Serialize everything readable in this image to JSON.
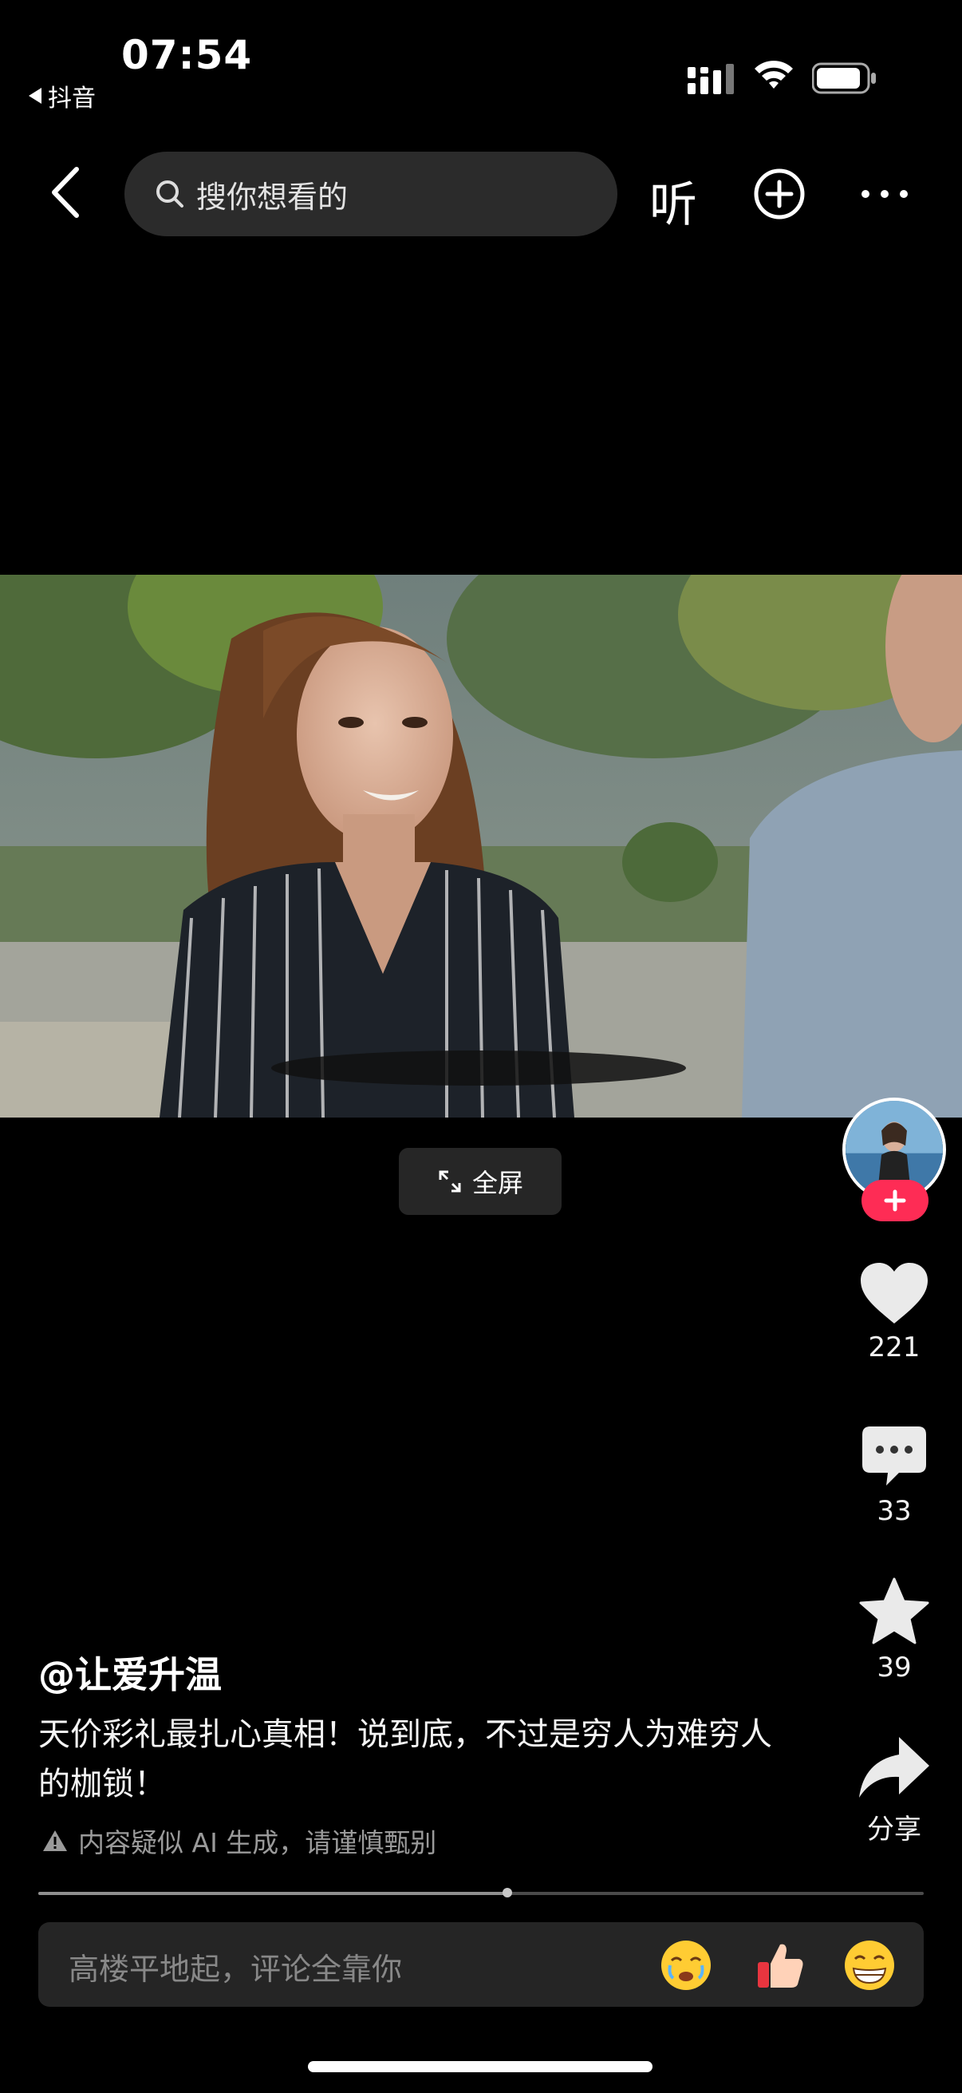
{
  "status_bar": {
    "back_app": "抖音",
    "time": "07:54"
  },
  "top_nav": {
    "search_placeholder": "搜你想看的",
    "listen_label": "听"
  },
  "video": {
    "fullscreen_label": "全屏"
  },
  "actions": {
    "likes": "221",
    "comments": "33",
    "favorites": "39",
    "share_label": "分享"
  },
  "post": {
    "author": "@让爱升温",
    "description": "天价彩礼最扎心真相！说到底，不过是穷人为难穷人的枷锁！",
    "ai_notice": "内容疑似 AI 生成，请谨慎甄别"
  },
  "playback": {
    "progress": 0.53
  },
  "comment_bar": {
    "placeholder": "高楼平地起，评论全靠你",
    "emojis": [
      "crying-emoji",
      "thumbs-up-emoji",
      "grin-emoji"
    ]
  },
  "colors": {
    "background": "#000000",
    "follow_red": "#fe2c55",
    "input_bg": "#252525"
  }
}
